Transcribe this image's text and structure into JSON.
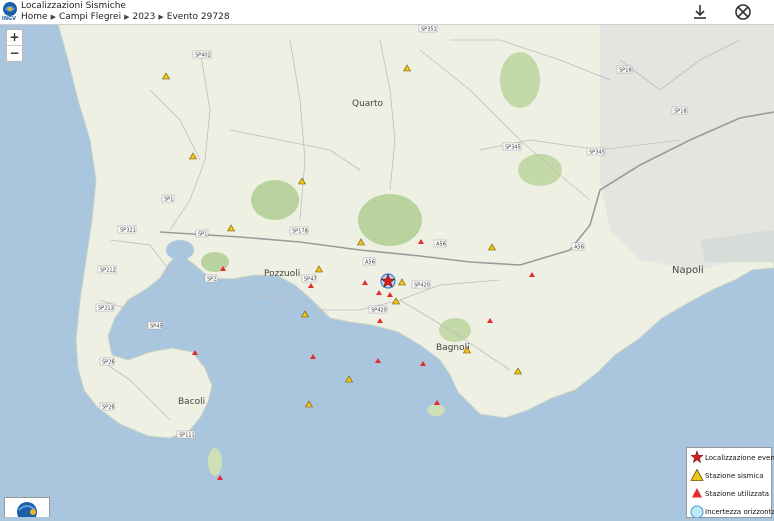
{
  "app": {
    "title": "Localizzazioni Sismiche",
    "logo_text": "INGV"
  },
  "breadcrumb": [
    "Home",
    "Campi Flegrei",
    "2023",
    "Evento 29728"
  ],
  "toolbar": {
    "download_icon": "download-icon",
    "close_icon": "crossed-circle-icon"
  },
  "zoom": {
    "in_label": "+",
    "out_label": "−"
  },
  "places": {
    "quarto": "Quarto",
    "pozzuoli": "Pozzuoli",
    "napoli": "Napoli",
    "bagnoli": "Bagnoli",
    "bacoli": "Bacoli"
  },
  "roads": [
    "SP402",
    "SP351",
    "SP18",
    "SP18",
    "SP345",
    "SP345",
    "SP1",
    "SP1",
    "SP178",
    "SP321",
    "A56",
    "A56",
    "A56",
    "SP212",
    "SP2",
    "SP47",
    "SP420",
    "SP420",
    "SP213",
    "SP45",
    "SP26",
    "SP26",
    "SP111"
  ],
  "legend": {
    "event": "Localizzazione evento",
    "station": "Stazione sismica",
    "used_station": "Stazione utilizzata",
    "uncertainty": "Incertezza orizzontale"
  },
  "colors": {
    "sea": "#a9c6de",
    "land": "#eef0e4",
    "park": "#b9d39e",
    "event_star": "#d21f1f",
    "station": "#f0c419",
    "used_station": "#e52b2b",
    "uncertainty": "#3b82d6"
  }
}
